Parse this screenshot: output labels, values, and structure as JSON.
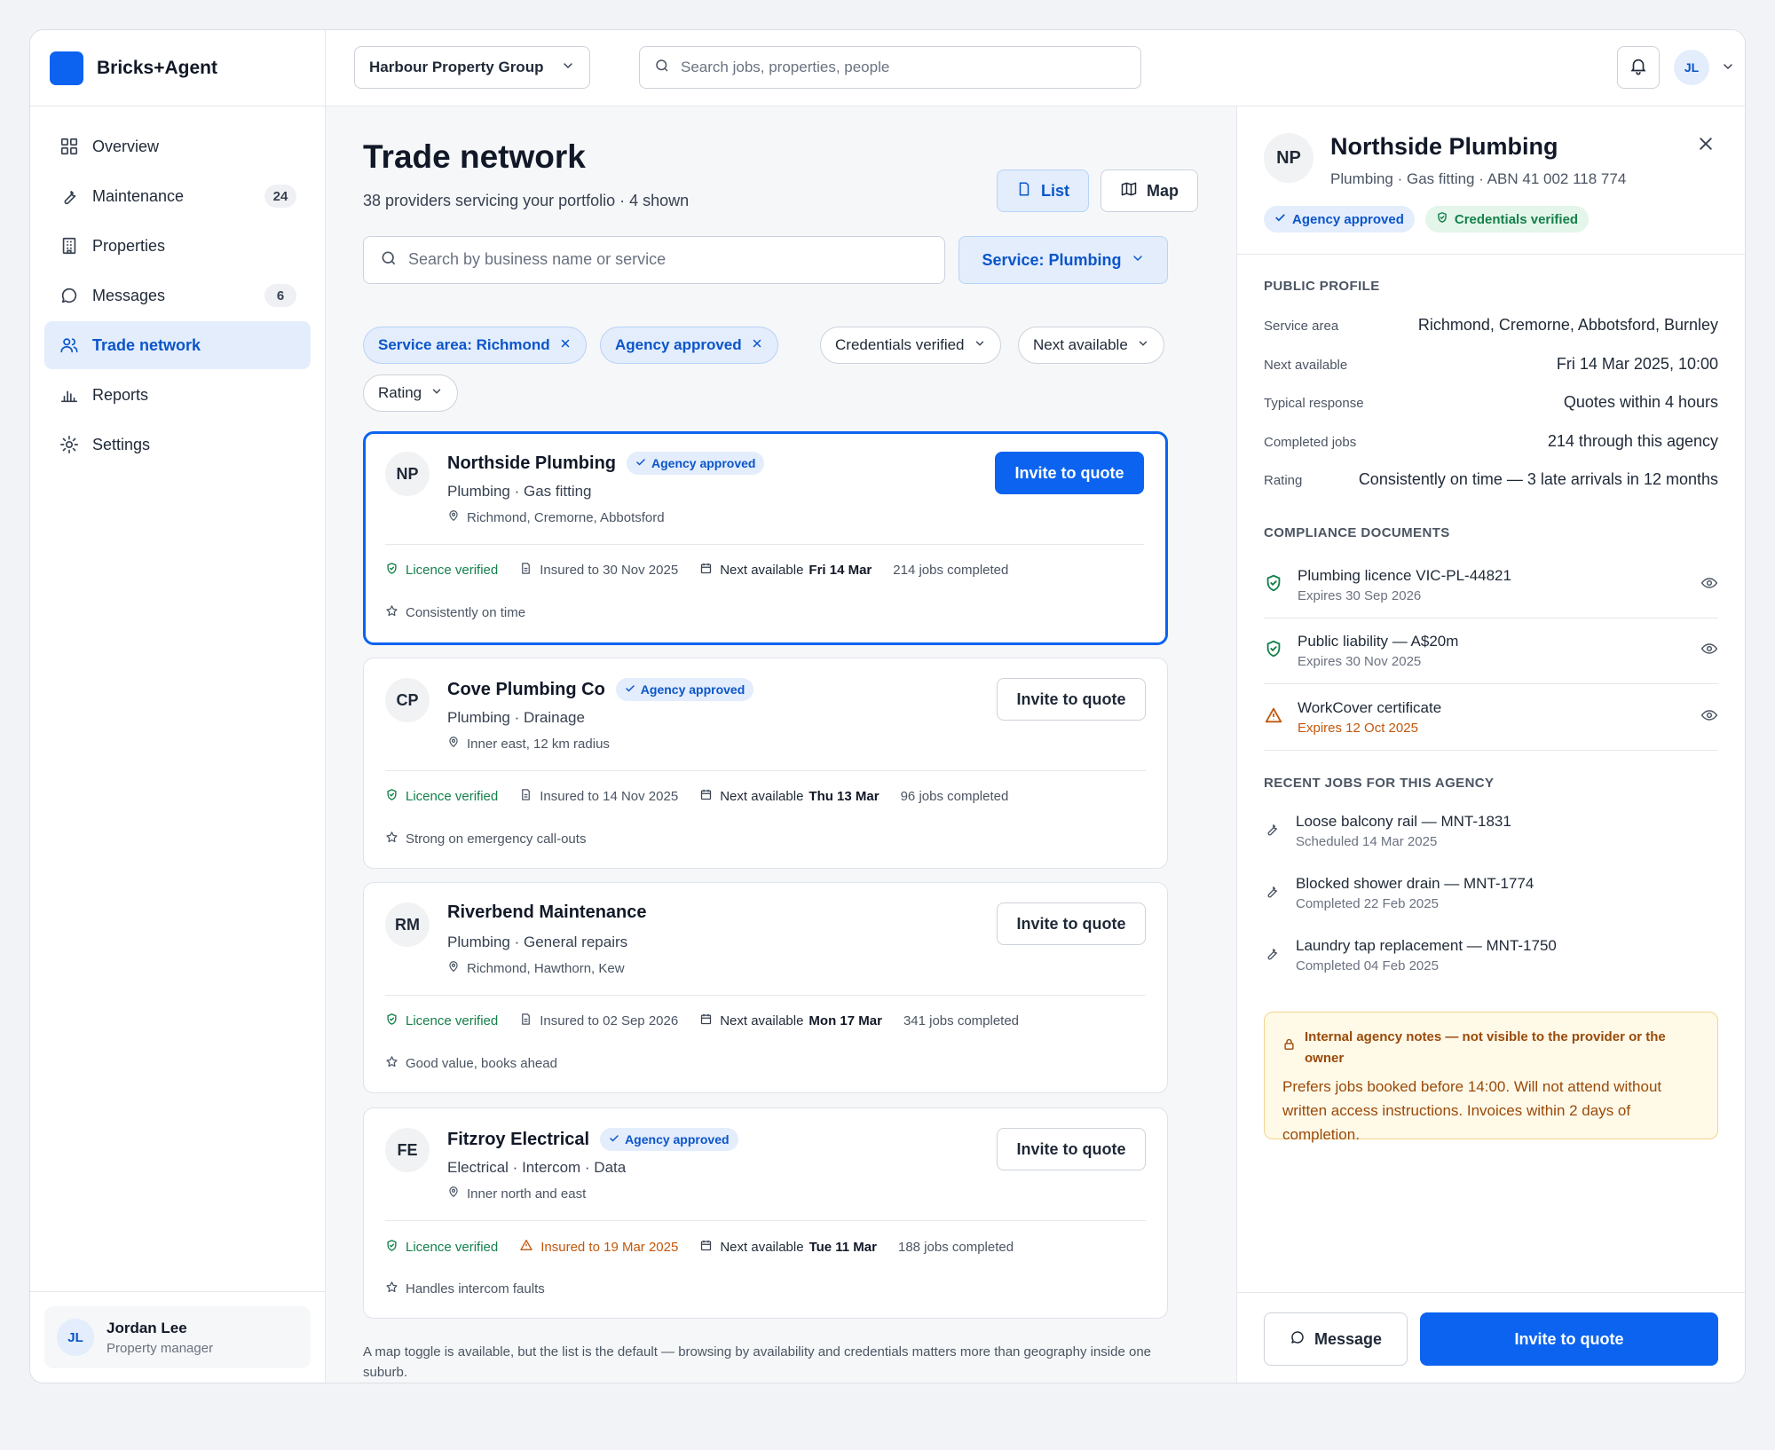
{
  "brand": {
    "name": "Bricks+Agent",
    "color": "#0b63f0"
  },
  "sidebar": {
    "items": [
      {
        "label": "Overview",
        "icon": "grid-icon",
        "badge": ""
      },
      {
        "label": "Maintenance",
        "icon": "wrench-icon",
        "badge": "24"
      },
      {
        "label": "Properties",
        "icon": "building-icon",
        "badge": ""
      },
      {
        "label": "Messages",
        "icon": "chat-icon",
        "badge": "6"
      },
      {
        "label": "Trade network",
        "icon": "users-icon",
        "badge": "",
        "active": true
      },
      {
        "label": "Reports",
        "icon": "bar-chart-icon",
        "badge": ""
      },
      {
        "label": "Settings",
        "icon": "gear-icon",
        "badge": ""
      }
    ],
    "user": {
      "initials": "JL",
      "name": "Jordan Lee",
      "role": "Property manager"
    }
  },
  "topbar": {
    "org": "Harbour Property Group",
    "search_placeholder": "Search jobs, properties, people",
    "avatar_initials": "JL"
  },
  "main": {
    "title": "Trade network",
    "subtitle": "38 providers servicing your portfolio · 4 shown",
    "view_list": "List",
    "view_map": "Map",
    "search_placeholder": "Search by business name or service",
    "service_filter": "Service: Plumbing",
    "chips": [
      {
        "label": "Service area: Richmond",
        "active": true
      },
      {
        "label": "Agency approved",
        "active": true
      },
      {
        "label": "Credentials verified",
        "active": false
      },
      {
        "label": "Next available",
        "active": false
      },
      {
        "label": "Rating",
        "active": false
      }
    ],
    "invite_label": "Invite to quote",
    "approved_label": "Agency approved",
    "licence_label": "Licence verified",
    "next_label": "Next available",
    "providers": [
      {
        "initials": "NP",
        "name": "Northside Plumbing",
        "approved": true,
        "services": "Plumbing · Gas fitting",
        "area": "Richmond, Cremorne, Abbotsford",
        "insured": "Insured to 30 Nov 2025",
        "insured_warn": false,
        "next": "Fri 14 Mar",
        "jobs": "214 jobs completed",
        "note": "Consistently on time",
        "selected": true
      },
      {
        "initials": "CP",
        "name": "Cove Plumbing Co",
        "approved": true,
        "services": "Plumbing · Drainage",
        "area": "Inner east, 12 km radius",
        "insured": "Insured to 14 Nov 2025",
        "insured_warn": false,
        "next": "Thu 13 Mar",
        "jobs": "96 jobs completed",
        "note": "Strong on emergency call-outs",
        "selected": false
      },
      {
        "initials": "RM",
        "name": "Riverbend Maintenance",
        "approved": false,
        "services": "Plumbing · General repairs",
        "area": "Richmond, Hawthorn, Kew",
        "insured": "Insured to 02 Sep 2026",
        "insured_warn": false,
        "next": "Mon 17 Mar",
        "jobs": "341 jobs completed",
        "note": "Good value, books ahead",
        "selected": false
      },
      {
        "initials": "FE",
        "name": "Fitzroy Electrical",
        "approved": true,
        "services": "Electrical · Intercom · Data",
        "area": "Inner north and east",
        "insured": "Insured to 19 Mar 2025",
        "insured_warn": true,
        "next": "Tue 11 Mar",
        "jobs": "188 jobs completed",
        "note": "Handles intercom faults",
        "selected": false
      }
    ],
    "footnote": "A map toggle is available, but the list is the default — browsing by availability and credentials matters more than geography inside one suburb."
  },
  "panel": {
    "initials": "NP",
    "name": "Northside Plumbing",
    "subtitle": "Plumbing · Gas fitting · ABN 41 002 118 774",
    "badge_approved": "Agency approved",
    "badge_verified": "Credentials verified",
    "public_profile_title": "PUBLIC PROFILE",
    "profile": [
      {
        "k": "Service area",
        "v": "Richmond, Cremorne, Abbotsford, Burnley"
      },
      {
        "k": "Next available",
        "v": "Fri 14 Mar 2025, 10:00"
      },
      {
        "k": "Typical response",
        "v": "Quotes within 4 hours"
      },
      {
        "k": "Completed jobs",
        "v": "214 through this agency"
      },
      {
        "k": "Rating",
        "v": "Consistently on time — 3 late arrivals in 12 months"
      }
    ],
    "compliance_title": "COMPLIANCE DOCUMENTS",
    "documents": [
      {
        "title": "Plumbing licence VIC-PL-44821",
        "sub": "Expires 30 Sep 2026",
        "warn": false
      },
      {
        "title": "Public liability — A$20m",
        "sub": "Expires 30 Nov 2025",
        "warn": false
      },
      {
        "title": "WorkCover certificate",
        "sub": "Expires 12 Oct 2025",
        "warn": true
      }
    ],
    "recent_title": "RECENT JOBS FOR THIS AGENCY",
    "jobs": [
      {
        "title": "Loose balcony rail — MNT-1831",
        "sub": "Scheduled 14 Mar 2025"
      },
      {
        "title": "Blocked shower drain — MNT-1774",
        "sub": "Completed 22 Feb 2025"
      },
      {
        "title": "Laundry tap replacement — MNT-1750",
        "sub": "Completed 04 Feb 2025"
      }
    ],
    "notes_title": "Internal agency notes — not visible to the provider or the owner",
    "notes_body": "Prefers jobs booked before 14:00. Will not attend without written access instructions. Invoices within 2 days of completion.",
    "message_label": "Message",
    "invite_label": "Invite to quote"
  }
}
